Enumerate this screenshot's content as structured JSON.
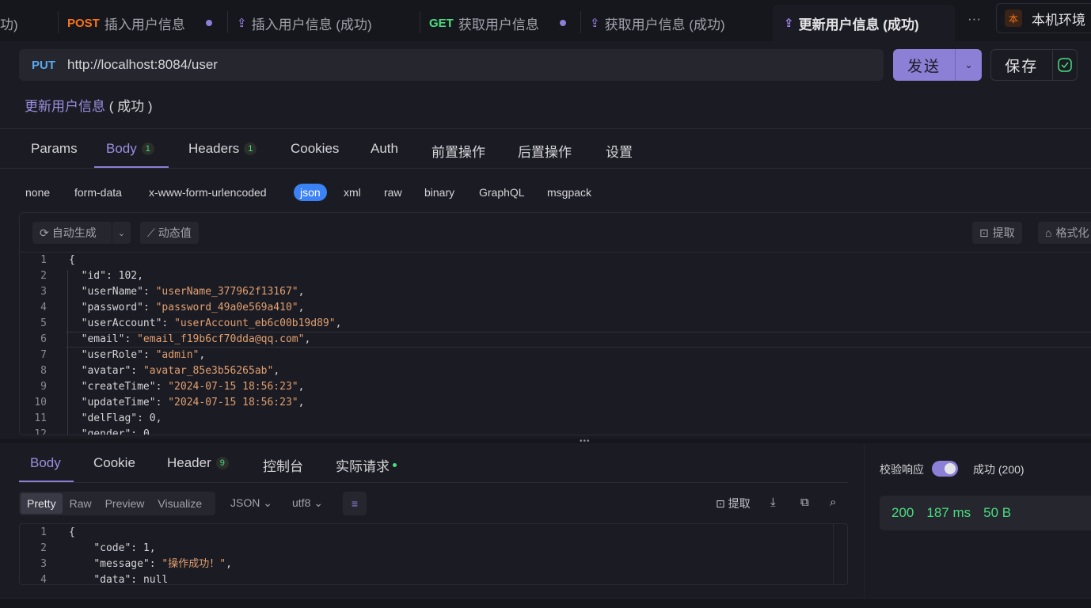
{
  "tabs": [
    {
      "method": "",
      "label": "功)",
      "dot": false
    },
    {
      "method": "POST",
      "label": "插入用户信息",
      "dot": true
    },
    {
      "method": "",
      "label": "插入用户信息 (成功)",
      "dot": false
    },
    {
      "method": "GET",
      "label": "获取用户信息",
      "dot": true
    },
    {
      "method": "",
      "label": "获取用户信息 (成功)",
      "dot": false
    },
    {
      "method": "",
      "label": "更新用户信息 (成功)",
      "dot": false,
      "active": true
    }
  ],
  "tab_more": "···",
  "env": {
    "icon_char": "本",
    "label": "本机环境"
  },
  "request": {
    "method": "PUT",
    "url": "http://localhost:8084/user",
    "send_label": "发送",
    "save_label": "保存"
  },
  "breadcrumb": {
    "name": "更新用户信息",
    "suffix": " ( 成功 )"
  },
  "request_tabs": [
    {
      "label": "Params"
    },
    {
      "label": "Body",
      "badge": "1",
      "active": true
    },
    {
      "label": "Headers",
      "badge": "1"
    },
    {
      "label": "Cookies"
    },
    {
      "label": "Auth"
    },
    {
      "label": "前置操作"
    },
    {
      "label": "后置操作"
    },
    {
      "label": "设置"
    }
  ],
  "body_types": [
    "none",
    "form-data",
    "x-www-form-urlencoded",
    "json",
    "xml",
    "raw",
    "binary",
    "GraphQL",
    "msgpack"
  ],
  "body_type_selected": "json",
  "editor_tools": {
    "auto_gen": "自动生成",
    "dynamic": "动态值",
    "extract": "提取",
    "format": "格式化"
  },
  "request_body_lines": [
    {
      "n": "1",
      "text": "{"
    },
    {
      "n": "2",
      "key": "\"id\"",
      "val": "102",
      "type": "num"
    },
    {
      "n": "3",
      "key": "\"userName\"",
      "val": "\"userName_377962f13167\"",
      "type": "str"
    },
    {
      "n": "4",
      "key": "\"password\"",
      "val": "\"password_49a0e569a410\"",
      "type": "str"
    },
    {
      "n": "5",
      "key": "\"userAccount\"",
      "val": "\"userAccount_eb6c00b19d89\"",
      "type": "str"
    },
    {
      "n": "6",
      "key": "\"email\"",
      "val": "\"email_f19b6cf70dda@qq.com\"",
      "type": "str"
    },
    {
      "n": "7",
      "key": "\"userRole\"",
      "val": "\"admin\"",
      "type": "str"
    },
    {
      "n": "8",
      "key": "\"avatar\"",
      "val": "\"avatar_85e3b56265ab\"",
      "type": "str"
    },
    {
      "n": "9",
      "key": "\"createTime\"",
      "val": "\"2024-07-15 18:56:23\"",
      "type": "str"
    },
    {
      "n": "10",
      "key": "\"updateTime\"",
      "val": "\"2024-07-15 18:56:23\"",
      "type": "str"
    },
    {
      "n": "11",
      "key": "\"delFlag\"",
      "val": "0",
      "type": "num"
    },
    {
      "n": "12",
      "key": "\"gender\"",
      "val": "0",
      "type": "num"
    }
  ],
  "response_tabs": [
    {
      "label": "Body",
      "active": true
    },
    {
      "label": "Cookie"
    },
    {
      "label": "Header",
      "badge": "9"
    },
    {
      "label": "控制台"
    },
    {
      "label": "实际请求",
      "dot": true
    }
  ],
  "response_formats": [
    "Pretty",
    "Raw",
    "Preview",
    "Visualize"
  ],
  "response_format_selected": "Pretty",
  "response_lang": "JSON",
  "response_encoding": "utf8",
  "response_extract": "提取",
  "response_body_lines": [
    {
      "n": "1",
      "text": "{"
    },
    {
      "n": "2",
      "key": "\"code\"",
      "val": "1",
      "type": "num"
    },
    {
      "n": "3",
      "key": "\"message\"",
      "val": "\"操作成功！\"",
      "type": "str"
    },
    {
      "n": "4",
      "key": "\"data\"",
      "val": "null",
      "type": "num"
    }
  ],
  "verify": {
    "label": "校验响应",
    "enabled": true,
    "result": "成功 (200)"
  },
  "stats": {
    "code": "200",
    "time": "187 ms",
    "size": "50 B"
  },
  "colors": {
    "accent": "#8b7fd6",
    "post": "#f97316",
    "get": "#4ade80",
    "put": "#5aa9ee",
    "success": "#4ade80"
  }
}
